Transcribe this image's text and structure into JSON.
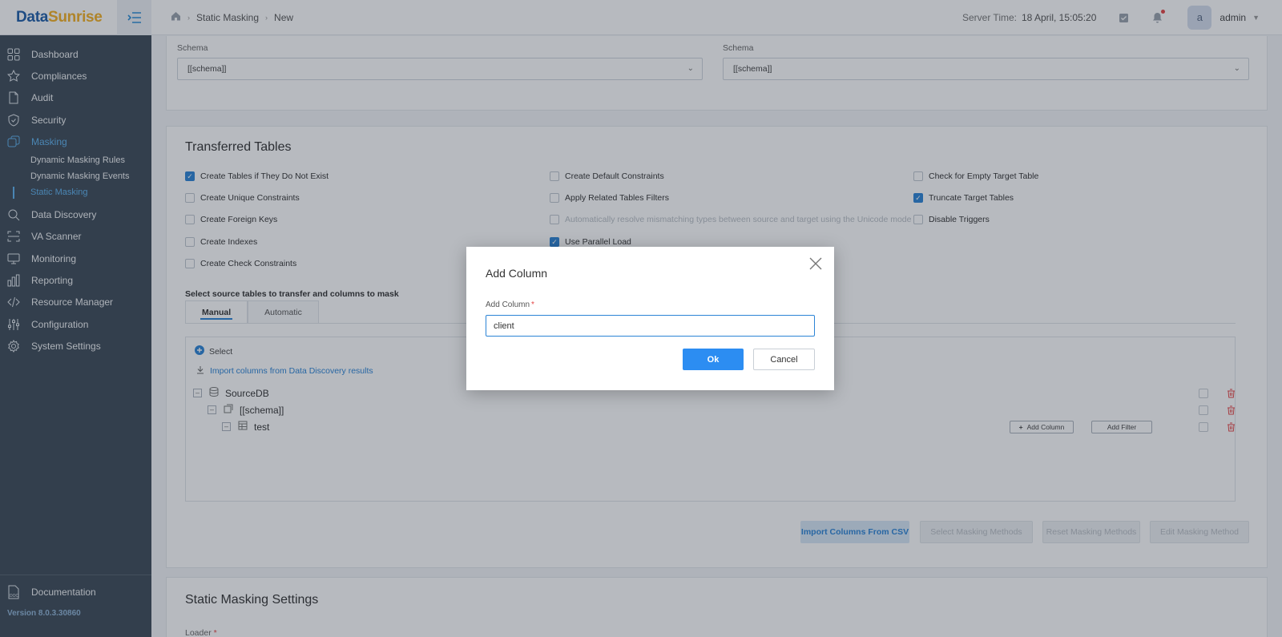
{
  "app": {
    "logo_part1": "Data",
    "logo_part2": "Sunrise",
    "version": "Version 8.0.3.30860"
  },
  "sidebar": {
    "items": [
      {
        "label": "Dashboard",
        "icon": "dashboard-icon"
      },
      {
        "label": "Compliances",
        "icon": "star-icon"
      },
      {
        "label": "Audit",
        "icon": "document-icon"
      },
      {
        "label": "Security",
        "icon": "shield-icon"
      },
      {
        "label": "Masking",
        "icon": "masking-icon",
        "active": true
      },
      {
        "label": "Data Discovery",
        "icon": "search-icon"
      },
      {
        "label": "VA Scanner",
        "icon": "scanner-icon"
      },
      {
        "label": "Monitoring",
        "icon": "monitor-icon"
      },
      {
        "label": "Reporting",
        "icon": "bar-chart-icon"
      },
      {
        "label": "Resource Manager",
        "icon": "code-icon"
      },
      {
        "label": "Configuration",
        "icon": "sliders-icon"
      },
      {
        "label": "System Settings",
        "icon": "gear-icon"
      }
    ],
    "masking_sub": [
      {
        "label": "Dynamic Masking Rules"
      },
      {
        "label": "Dynamic Masking Events"
      },
      {
        "label": "Static Masking",
        "active": true
      }
    ],
    "documentation": "Documentation"
  },
  "topbar": {
    "breadcrumb": [
      "Static Masking",
      "New"
    ],
    "server_time_label": "Server Time:",
    "server_time": "18 April, 15:05:20",
    "avatar_letter": "a",
    "user": "admin"
  },
  "schema_section": {
    "left_label": "Schema",
    "left_value": "[[schema]]",
    "right_label": "Schema",
    "right_value": "[[schema]]"
  },
  "transferred": {
    "title": "Transferred Tables",
    "options": [
      {
        "label": "Create Tables if They Do Not Exist",
        "checked": true
      },
      {
        "label": "Create Unique Constraints",
        "checked": false
      },
      {
        "label": "Create Foreign Keys",
        "checked": false
      },
      {
        "label": "Create Indexes",
        "checked": false
      },
      {
        "label": "Create Check Constraints",
        "checked": false
      },
      {
        "label": "Create Default Constraints",
        "checked": false
      },
      {
        "label": "Apply Related Tables Filters",
        "checked": false
      },
      {
        "label": "Automatically resolve mismatching types between source and target using the Unicode mode",
        "checked": false,
        "disabled": true
      },
      {
        "label": "Use Parallel Load",
        "checked": true
      },
      {
        "label": "Check for Empty Target Table",
        "checked": false
      },
      {
        "label": "Truncate Target Tables",
        "checked": true
      },
      {
        "label": "Disable Triggers",
        "checked": false
      }
    ],
    "select_label": "Select source tables to transfer and columns to mask",
    "tabs": [
      "Manual",
      "Automatic"
    ],
    "select_link": "Select",
    "import_link": "Import columns from Data Discovery results",
    "tree": {
      "db": "SourceDB",
      "schema": "[[schema]]",
      "table": "test"
    },
    "add_column_btn": "Add Column",
    "add_filter_btn": "Add Filter",
    "actions": {
      "import_csv": "Import Columns From CSV",
      "action2": "Select Masking Methods",
      "action3": "Reset Masking Methods",
      "action4": "Edit Masking Method"
    }
  },
  "settings": {
    "title": "Static Masking Settings",
    "loader_label": "Loader"
  },
  "modal": {
    "title": "Add Column",
    "field_label": "Add Column",
    "required_mark": "*",
    "value": "client",
    "ok": "Ok",
    "cancel": "Cancel"
  }
}
